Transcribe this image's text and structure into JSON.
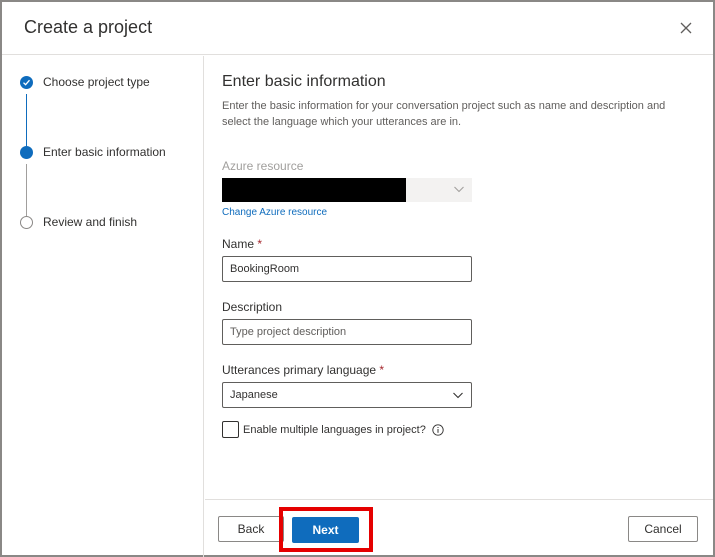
{
  "dialog": {
    "title": "Create a project",
    "close_icon": "close-icon"
  },
  "steps": [
    {
      "label": "Choose project type",
      "state": "done"
    },
    {
      "label": "Enter basic information",
      "state": "current"
    },
    {
      "label": "Review and finish",
      "state": "pending"
    }
  ],
  "form": {
    "title": "Enter basic information",
    "description": "Enter the basic information for your conversation project such as name and description and select the language which your utterances are in.",
    "azure_resource": {
      "label": "Azure resource",
      "value": "",
      "link": "Change Azure resource"
    },
    "name": {
      "label": "Name",
      "required_mark": "*",
      "value": "BookingRoom"
    },
    "description_field": {
      "label": "Description",
      "placeholder": "Type project description"
    },
    "language": {
      "label": "Utterances primary language",
      "required_mark": "*",
      "selected": "Japanese"
    },
    "multi_language": {
      "label": "Enable multiple languages in project?",
      "checked": false
    }
  },
  "footer": {
    "back": "Back",
    "next": "Next",
    "cancel": "Cancel"
  },
  "colors": {
    "accent": "#0f6cbd",
    "highlight": "#e50000",
    "required": "#a4262c"
  }
}
